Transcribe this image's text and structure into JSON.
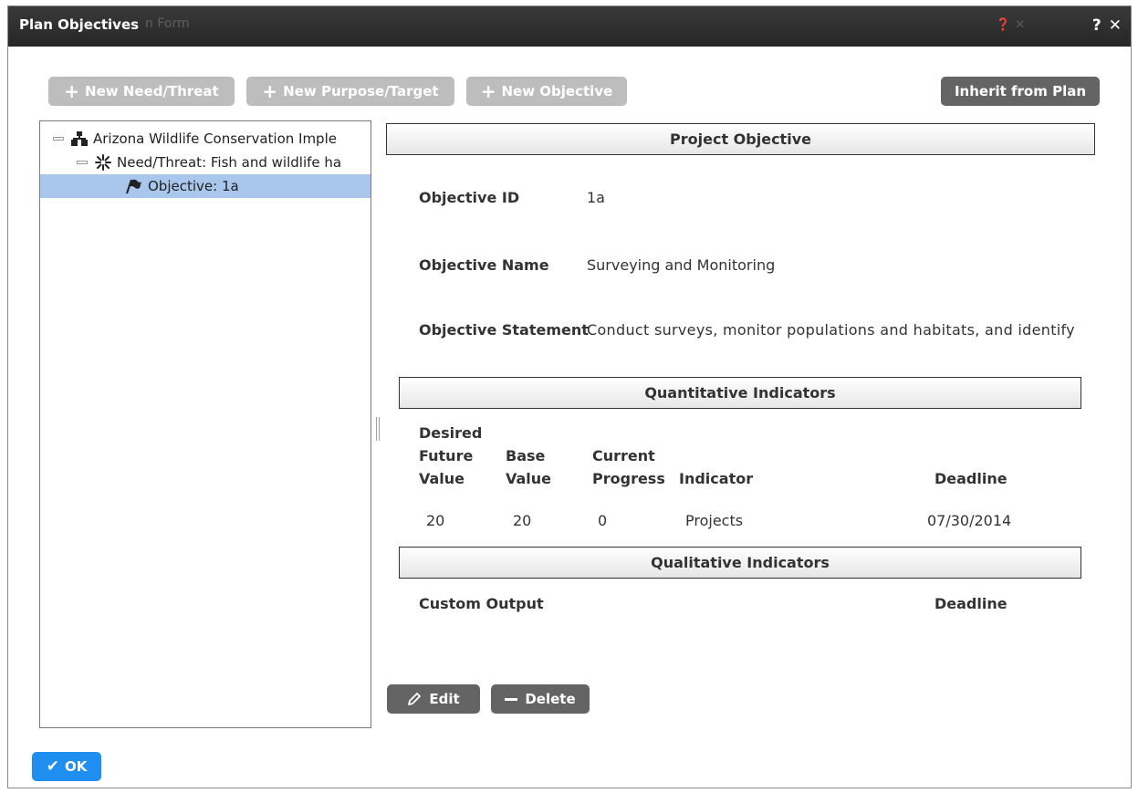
{
  "dialog": {
    "title": "Plan Objectives",
    "ghost_title": "n Form",
    "ghost_icons": "❓ ✕",
    "ghost_text": "",
    "help_icon": "help-icon",
    "close_icon": "close-icon"
  },
  "toolbar": {
    "new_need_label": "New Need/Threat",
    "new_purpose_label": "New Purpose/Target",
    "new_objective_label": "New Objective",
    "inherit_label": "Inherit from Plan"
  },
  "tree": {
    "items": [
      {
        "label": "Arizona Wildlife Conservation Imple",
        "icon": "hierarchy-icon",
        "level": 0
      },
      {
        "label": "Need/Threat: Fish and wildlife ha",
        "icon": "starburst-icon",
        "level": 1
      },
      {
        "label": "Objective: 1a",
        "icon": "flag-icon",
        "level": 2,
        "selected": true
      }
    ]
  },
  "detail": {
    "section_title": "Project Objective",
    "objective_id_label": "Objective ID",
    "objective_id": "1a",
    "objective_name_label": "Objective Name",
    "objective_name": "Surveying and Monitoring",
    "objective_statement_label": "Objective Statement",
    "objective_statement": "Conduct surveys, monitor populations and habitats, and identify"
  },
  "quantitative": {
    "section_title": "Quantitative Indicators",
    "headers": {
      "desired_future_value": [
        "Desired",
        "Future",
        "Value"
      ],
      "base_value": [
        "Base",
        "Value"
      ],
      "current_progress": [
        "Current",
        "Progress"
      ],
      "indicator": "Indicator",
      "deadline": "Deadline"
    },
    "rows": [
      {
        "desired_future_value": "20",
        "base_value": "20",
        "current_progress": "0",
        "indicator": "Projects",
        "deadline": "07/30/2014"
      }
    ]
  },
  "qualitative": {
    "section_title": "Qualitative Indicators",
    "custom_output_label": "Custom Output",
    "deadline_label": "Deadline"
  },
  "actions": {
    "edit_label": "Edit",
    "delete_label": "Delete",
    "ok_label": "OK"
  },
  "colors": {
    "titlebar": "#2e2e2e",
    "selected_row": "#a9c6ed",
    "ok_button": "#1f8ef1",
    "disabled_button": "#bdbdbd",
    "dark_button": "#646464"
  }
}
